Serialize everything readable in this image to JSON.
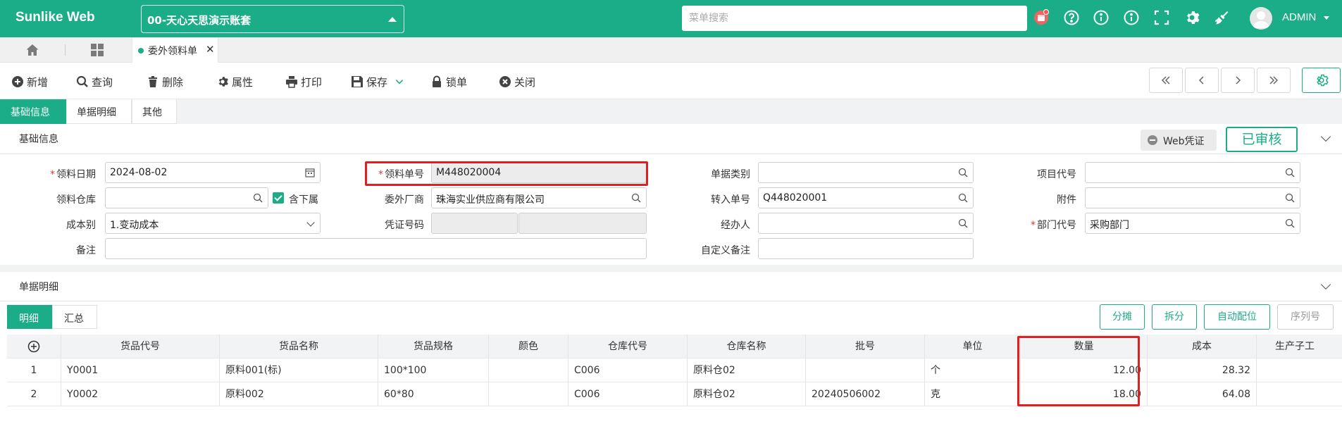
{
  "header": {
    "brand": "Sunlike Web",
    "account": "00-天心天思演示账套",
    "search_placeholder": "菜单搜索",
    "user": "ADMIN"
  },
  "tabs": {
    "doc_tab_label": "委外领料单"
  },
  "toolbar": {
    "add": "新增",
    "query": "查询",
    "delete": "删除",
    "props": "属性",
    "print": "打印",
    "save": "保存",
    "lock": "锁单",
    "close": "关闭"
  },
  "section_tabs": [
    "基础信息",
    "单据明细",
    "其他"
  ],
  "basic": {
    "title": "基础信息",
    "web_voucher": "Web凭证",
    "status": "已审核",
    "fields": {
      "date_label": "领料日期",
      "date_value": "2024-08-02",
      "no_label": "领料单号",
      "no_value": "M448020004",
      "category_label": "单据类别",
      "category_value": "",
      "project_label": "项目代号",
      "project_value": "",
      "warehouse_label": "领料仓库",
      "warehouse_value": "",
      "include_sub_label": "含下属",
      "vendor_label": "委外厂商",
      "vendor_value": "珠海实业供应商有限公司",
      "transfer_label": "转入单号",
      "transfer_value": "Q448020001",
      "attach_label": "附件",
      "attach_value": "",
      "cost_label": "成本别",
      "cost_value": "1.变动成本",
      "voucher_label": "凭证号码",
      "voucher_value1": "",
      "voucher_value2": "",
      "handler_label": "经办人",
      "handler_value": "",
      "dept_label": "部门代号",
      "dept_value": "采购部门",
      "remark_label": "备注",
      "remark_value": "",
      "custom_remark_label": "自定义备注",
      "custom_remark_value": ""
    }
  },
  "detail": {
    "title": "单据明细",
    "subtabs": [
      "明细",
      "汇总"
    ],
    "buttons": [
      "分摊",
      "拆分",
      "自动配位",
      "序列号"
    ],
    "columns": [
      "货品代号",
      "货品名称",
      "货品规格",
      "颜色",
      "仓库代号",
      "仓库名称",
      "批号",
      "单位",
      "数量",
      "成本",
      "生产子工"
    ],
    "rows": [
      {
        "idx": "1",
        "code": "Y0001",
        "name": "原料001(标)",
        "spec": "100*100",
        "color": "",
        "wh_code": "C006",
        "wh_name": "原料仓02",
        "batch": "",
        "unit": "个",
        "qty": "12.00",
        "cost": "28.32",
        "proc": ""
      },
      {
        "idx": "2",
        "code": "Y0002",
        "name": "原料002",
        "spec": "60*80",
        "color": "",
        "wh_code": "C006",
        "wh_name": "原料仓02",
        "batch": "20240506002",
        "unit": "克",
        "qty": "18.00",
        "cost": "64.08",
        "proc": ""
      }
    ]
  }
}
